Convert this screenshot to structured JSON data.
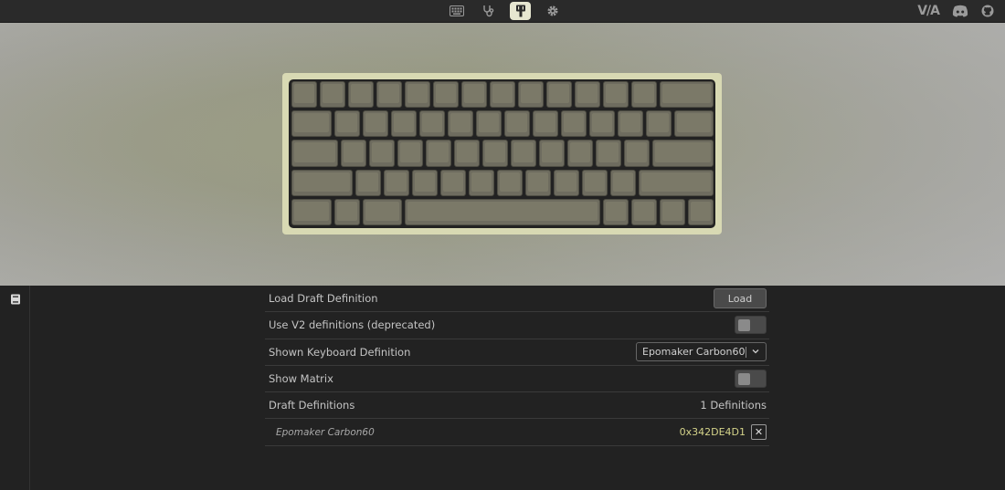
{
  "topbar": {
    "nav": [
      {
        "name": "keyboard-icon",
        "active": false
      },
      {
        "name": "stethoscope-icon",
        "active": false
      },
      {
        "name": "brush-icon",
        "active": true
      },
      {
        "name": "gear-icon",
        "active": false
      }
    ],
    "via_logo": "V/A"
  },
  "keyboard": {
    "name": "Epomaker Carbon60"
  },
  "settings": {
    "load_draft_label": "Load Draft Definition",
    "load_button": "Load",
    "use_v2_label": "Use V2 definitions (deprecated)",
    "use_v2_on": false,
    "shown_def_label": "Shown Keyboard Definition",
    "shown_def_value": "Epomaker Carbon60",
    "show_matrix_label": "Show Matrix",
    "show_matrix_on": false,
    "draft_defs_label": "Draft Definitions",
    "draft_defs_count": "1 Definitions",
    "draft_items": [
      {
        "name": "Epomaker Carbon60",
        "id": "0x342DE4D1",
        "remove": "✕"
      }
    ]
  },
  "colors": {
    "accent": "#e6e6d0",
    "case": "#d8d9b3",
    "keycap": "#6e6c5f",
    "hash_text": "#d4d38a"
  }
}
